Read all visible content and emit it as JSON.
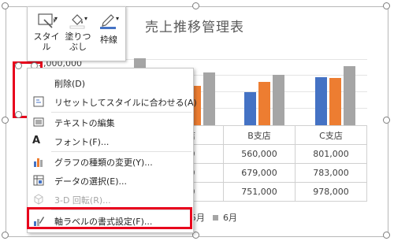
{
  "chart": {
    "title": "売上推移管理表",
    "y_axis_top_label": "1,000,000",
    "categories": [
      "A支店",
      "B支店",
      "C支店"
    ],
    "visible_category_labels": [
      "支店",
      "B支店",
      "C支店"
    ],
    "table_rows": [
      [
        "000",
        "560,000",
        "801,000"
      ],
      [
        "000",
        "679,000",
        "783,000"
      ],
      [
        "000",
        "751,000",
        "978,000"
      ]
    ],
    "legend": [
      "5月",
      "6月"
    ],
    "colors": {
      "series1": "#4472c4",
      "series2": "#ed7d31",
      "series3": "#a5a5a5"
    }
  },
  "chart_data": {
    "type": "bar",
    "title": "売上推移管理表",
    "categories": [
      "B支店",
      "C支店"
    ],
    "series": [
      {
        "name": "",
        "values": [
          560000,
          801000
        ]
      },
      {
        "name": "5月",
        "values": [
          679000,
          783000
        ]
      },
      {
        "name": "6月",
        "values": [
          751000,
          978000
        ]
      }
    ],
    "ylim": [
      0,
      1000000
    ]
  },
  "toolbar": {
    "style_label": "スタイル",
    "fill_label_1": "塗りつ",
    "fill_label_2": "ぶし",
    "outline_label": "枠線"
  },
  "context_menu": {
    "items": [
      {
        "label": "削除(D)"
      },
      {
        "label": "リセットしてスタイルに合わせる(A)"
      },
      {
        "label": "テキストの編集"
      },
      {
        "label": "フォント(F)..."
      },
      {
        "label": "グラフの種類の変更(Y)..."
      },
      {
        "label": "データの選択(E)..."
      },
      {
        "label": "3-D 回転(R)..."
      },
      {
        "label": "軸ラベルの書式設定(F)..."
      }
    ]
  }
}
